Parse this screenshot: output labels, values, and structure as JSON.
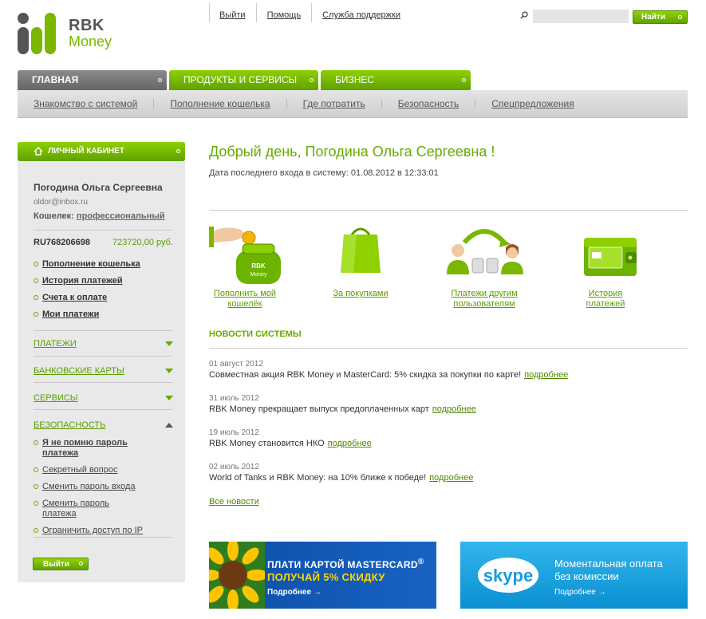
{
  "logo": {
    "line1": "RBK",
    "line2": "Money"
  },
  "topnav": {
    "logout": "Выйти",
    "help": "Помощь",
    "support": "Служба поддержки"
  },
  "search": {
    "placeholder": "",
    "button": "Найти"
  },
  "tabs": [
    {
      "label": "Главная"
    },
    {
      "label": "Продукты и сервисы"
    },
    {
      "label": "Бизнес"
    }
  ],
  "subnav": [
    "Знакомство с системой",
    "Пополнение кошелька",
    "Где потратить",
    "Безопасность",
    "Спецпредложения"
  ],
  "sidebar": {
    "cabinet": "ЛИЧНЫЙ КАБИНЕТ",
    "user_name": "Погодина Ольга Сергеевна",
    "email": "oldor@inbox.ru",
    "wallet_label": "Кошелек:",
    "wallet_type": "профессиональный",
    "account_id": "RU768206698",
    "balance": "723720,00 руб.",
    "menu": [
      "Пополнение кошелька",
      "История платежей",
      "Счета к оплате",
      "Мои платежи"
    ],
    "sections": [
      "ПЛАТЕЖИ",
      "БАНКОВСКИЕ КАРТЫ",
      "СЕРВИСЫ",
      "БЕЗОПАСНОСТЬ"
    ],
    "security_menu": [
      "Я не помню пароль платежа",
      "Секретный вопрос",
      "Сменить пароль входа",
      "Сменить пароль платежа",
      "Ограничить доступ по IP"
    ],
    "logout": "Выйти"
  },
  "main": {
    "greeting": "Добрый день, Погодина Ольга Сергеевна !",
    "last_login": "Дата последнего входа в систему: 01.08.2012 в 12:33:01",
    "quick": [
      {
        "line1": "Пополнить мой",
        "line2": "кошелёк"
      },
      {
        "line1": "За покупками",
        "line2": ""
      },
      {
        "line1": "Платежи другим",
        "line2": "пользователям"
      },
      {
        "line1": "История",
        "line2": "платежей"
      }
    ],
    "news_title": "НОВОСТИ СИСТЕМЫ",
    "news": [
      {
        "date": "01 август 2012",
        "text": "Совместная акция RBK Money и MasterCard: 5% скидка за покупки по карте!",
        "more": "подробнее"
      },
      {
        "date": "31 июль 2012",
        "text": "RBK Money прекращает выпуск предоплаченных карт",
        "more": "подробнее"
      },
      {
        "date": "19 июль 2012",
        "text": "RBK Money становится НКО",
        "more": "подробнее"
      },
      {
        "date": "02 июль 2012",
        "text": "World of Tanks и RBK Money: на 10% ближе к победе!",
        "more": "подробнее"
      }
    ],
    "all_news": "Все новости"
  },
  "banners": {
    "mastercard": {
      "line1": "ПЛАТИ КАРТОЙ MASTERCARD",
      "reg": "®",
      "line2": "ПОЛУЧАЙ 5% СКИДКУ",
      "more": "Подробнее →"
    },
    "skype": {
      "logo": "skype",
      "line1": "Моментальная оплата",
      "line2": "без комиссии",
      "more": "Подробнее →"
    }
  },
  "colors": {
    "brand_green": "#67ab00",
    "tab_gray": "#777777",
    "mc_blue": "#0a4fa8",
    "skype_blue": "#1ea6e6"
  }
}
